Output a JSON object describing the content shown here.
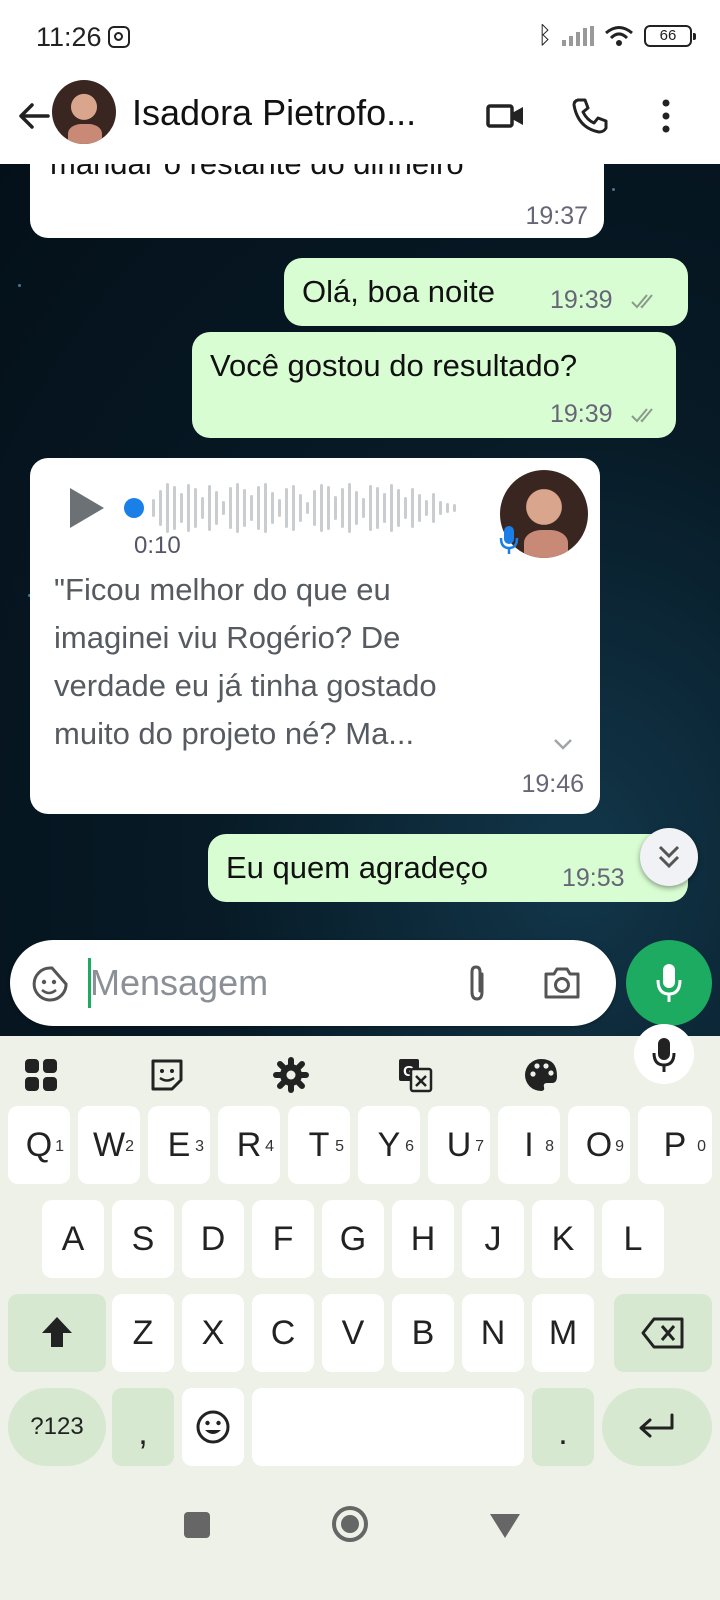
{
  "status_bar": {
    "time": "11:26",
    "battery": "66"
  },
  "header": {
    "contact_name": "Isadora Pietrofo..."
  },
  "messages": [
    {
      "dir": "in",
      "text": "mandar o restante do dinheiro",
      "time": "19:37"
    },
    {
      "dir": "out",
      "text": "Olá, boa noite",
      "time": "19:39"
    },
    {
      "dir": "out",
      "text": "Você gostou do resultado?",
      "time": "19:39"
    },
    {
      "dir": "in",
      "type": "voice",
      "duration": "0:10",
      "transcript": [
        "\"Ficou melhor do que eu",
        "imaginei viu Rogério? De",
        "verdade eu já tinha gostado",
        "muito do projeto né? Ma..."
      ],
      "time": "19:46"
    },
    {
      "dir": "out",
      "text": "Eu quem agradeço",
      "time": "19:53"
    }
  ],
  "composer": {
    "placeholder": "Mensagem"
  },
  "keyboard": {
    "row1": [
      "Q",
      "W",
      "E",
      "R",
      "T",
      "Y",
      "U",
      "I",
      "O",
      "P"
    ],
    "row1_hints": [
      "1",
      "2",
      "3",
      "4",
      "5",
      "6",
      "7",
      "8",
      "9",
      "0"
    ],
    "row2": [
      "A",
      "S",
      "D",
      "F",
      "G",
      "H",
      "J",
      "K",
      "L"
    ],
    "row3": [
      "Z",
      "X",
      "C",
      "V",
      "B",
      "N",
      "M"
    ],
    "symbols_label": "?123",
    "comma": ",",
    "period": "."
  },
  "colors": {
    "accent": "#1daa61",
    "outgoing_bubble": "#d9fdd3",
    "incoming_bubble": "#ffffff",
    "keyboard_bg": "#eef1e8"
  },
  "icons": [
    "back-arrow-icon",
    "video-call-icon",
    "phone-icon",
    "more-vert-icon",
    "sticker-icon",
    "attach-icon",
    "camera-icon",
    "mic-icon",
    "play-icon",
    "chevron-down-icon",
    "double-chevron-down-icon"
  ]
}
